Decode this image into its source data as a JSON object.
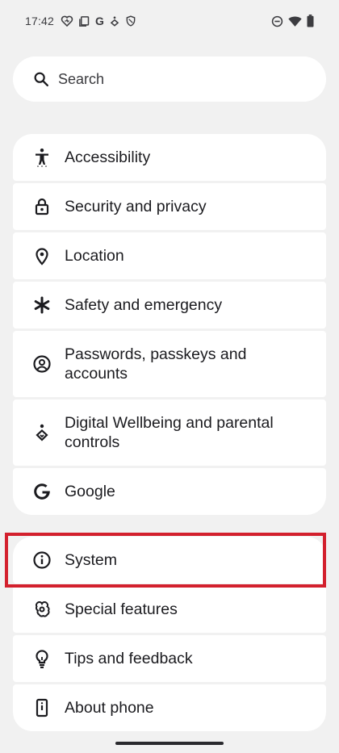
{
  "status_bar": {
    "time": "17:42",
    "left_icons": [
      "heart-icon",
      "copy-icon",
      "google-g-icon",
      "wellbeing-icon",
      "shield-icon"
    ],
    "google_letter": "G",
    "right_icons": [
      "dnd-icon",
      "wifi-icon",
      "battery-icon"
    ]
  },
  "search": {
    "placeholder": "Search",
    "icon": "search-icon"
  },
  "settings_groups": [
    {
      "items": [
        {
          "label": "Accessibility",
          "icon": "accessibility-icon"
        },
        {
          "label": "Security and privacy",
          "icon": "lock-icon"
        },
        {
          "label": "Location",
          "icon": "location-pin-icon"
        },
        {
          "label": "Safety and emergency",
          "icon": "asterisk-icon"
        },
        {
          "label": "Passwords, passkeys and accounts",
          "icon": "account-circle-icon"
        },
        {
          "label": "Digital Wellbeing and parental controls",
          "icon": "wellbeing-icon"
        },
        {
          "label": "Google",
          "icon": "google-g-icon"
        }
      ]
    },
    {
      "items": [
        {
          "label": "System",
          "icon": "info-icon",
          "highlighted": true
        },
        {
          "label": "Special features",
          "icon": "special-features-icon"
        },
        {
          "label": "Tips and feedback",
          "icon": "lightbulb-icon"
        },
        {
          "label": "About phone",
          "icon": "phone-icon"
        }
      ]
    }
  ],
  "colors": {
    "background": "#f1f1f1",
    "card": "#ffffff",
    "highlight": "#d3202d",
    "text": "#1b1b1f"
  }
}
